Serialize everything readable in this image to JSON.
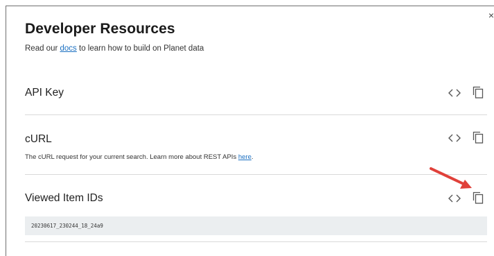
{
  "panel": {
    "close_symbol": "×",
    "title": "Developer Resources",
    "subtitle": {
      "prefix": "Read our ",
      "link": "docs",
      "suffix": " to learn how to build on Planet data"
    }
  },
  "rows": [
    {
      "title": "API Key",
      "icons": [
        "code-icon",
        "copy-icon"
      ]
    },
    {
      "title": "cURL",
      "description": {
        "prefix": "The cURL request for your current search. Learn more about REST APIs ",
        "link": "here",
        "suffix": "."
      },
      "icons": [
        "code-icon",
        "copy-icon"
      ]
    },
    {
      "title": "Viewed Item IDs",
      "item_id": "20230617_230244_18_24a9",
      "icons": [
        "code-icon",
        "copy-icon"
      ]
    }
  ],
  "annotation": {
    "arrow_color": "#e0413a",
    "points_to": "copy-icon"
  },
  "colors": {
    "link": "#1a6fc1",
    "id_box_bg": "#ebeef0",
    "divider": "#d9d9d9"
  }
}
